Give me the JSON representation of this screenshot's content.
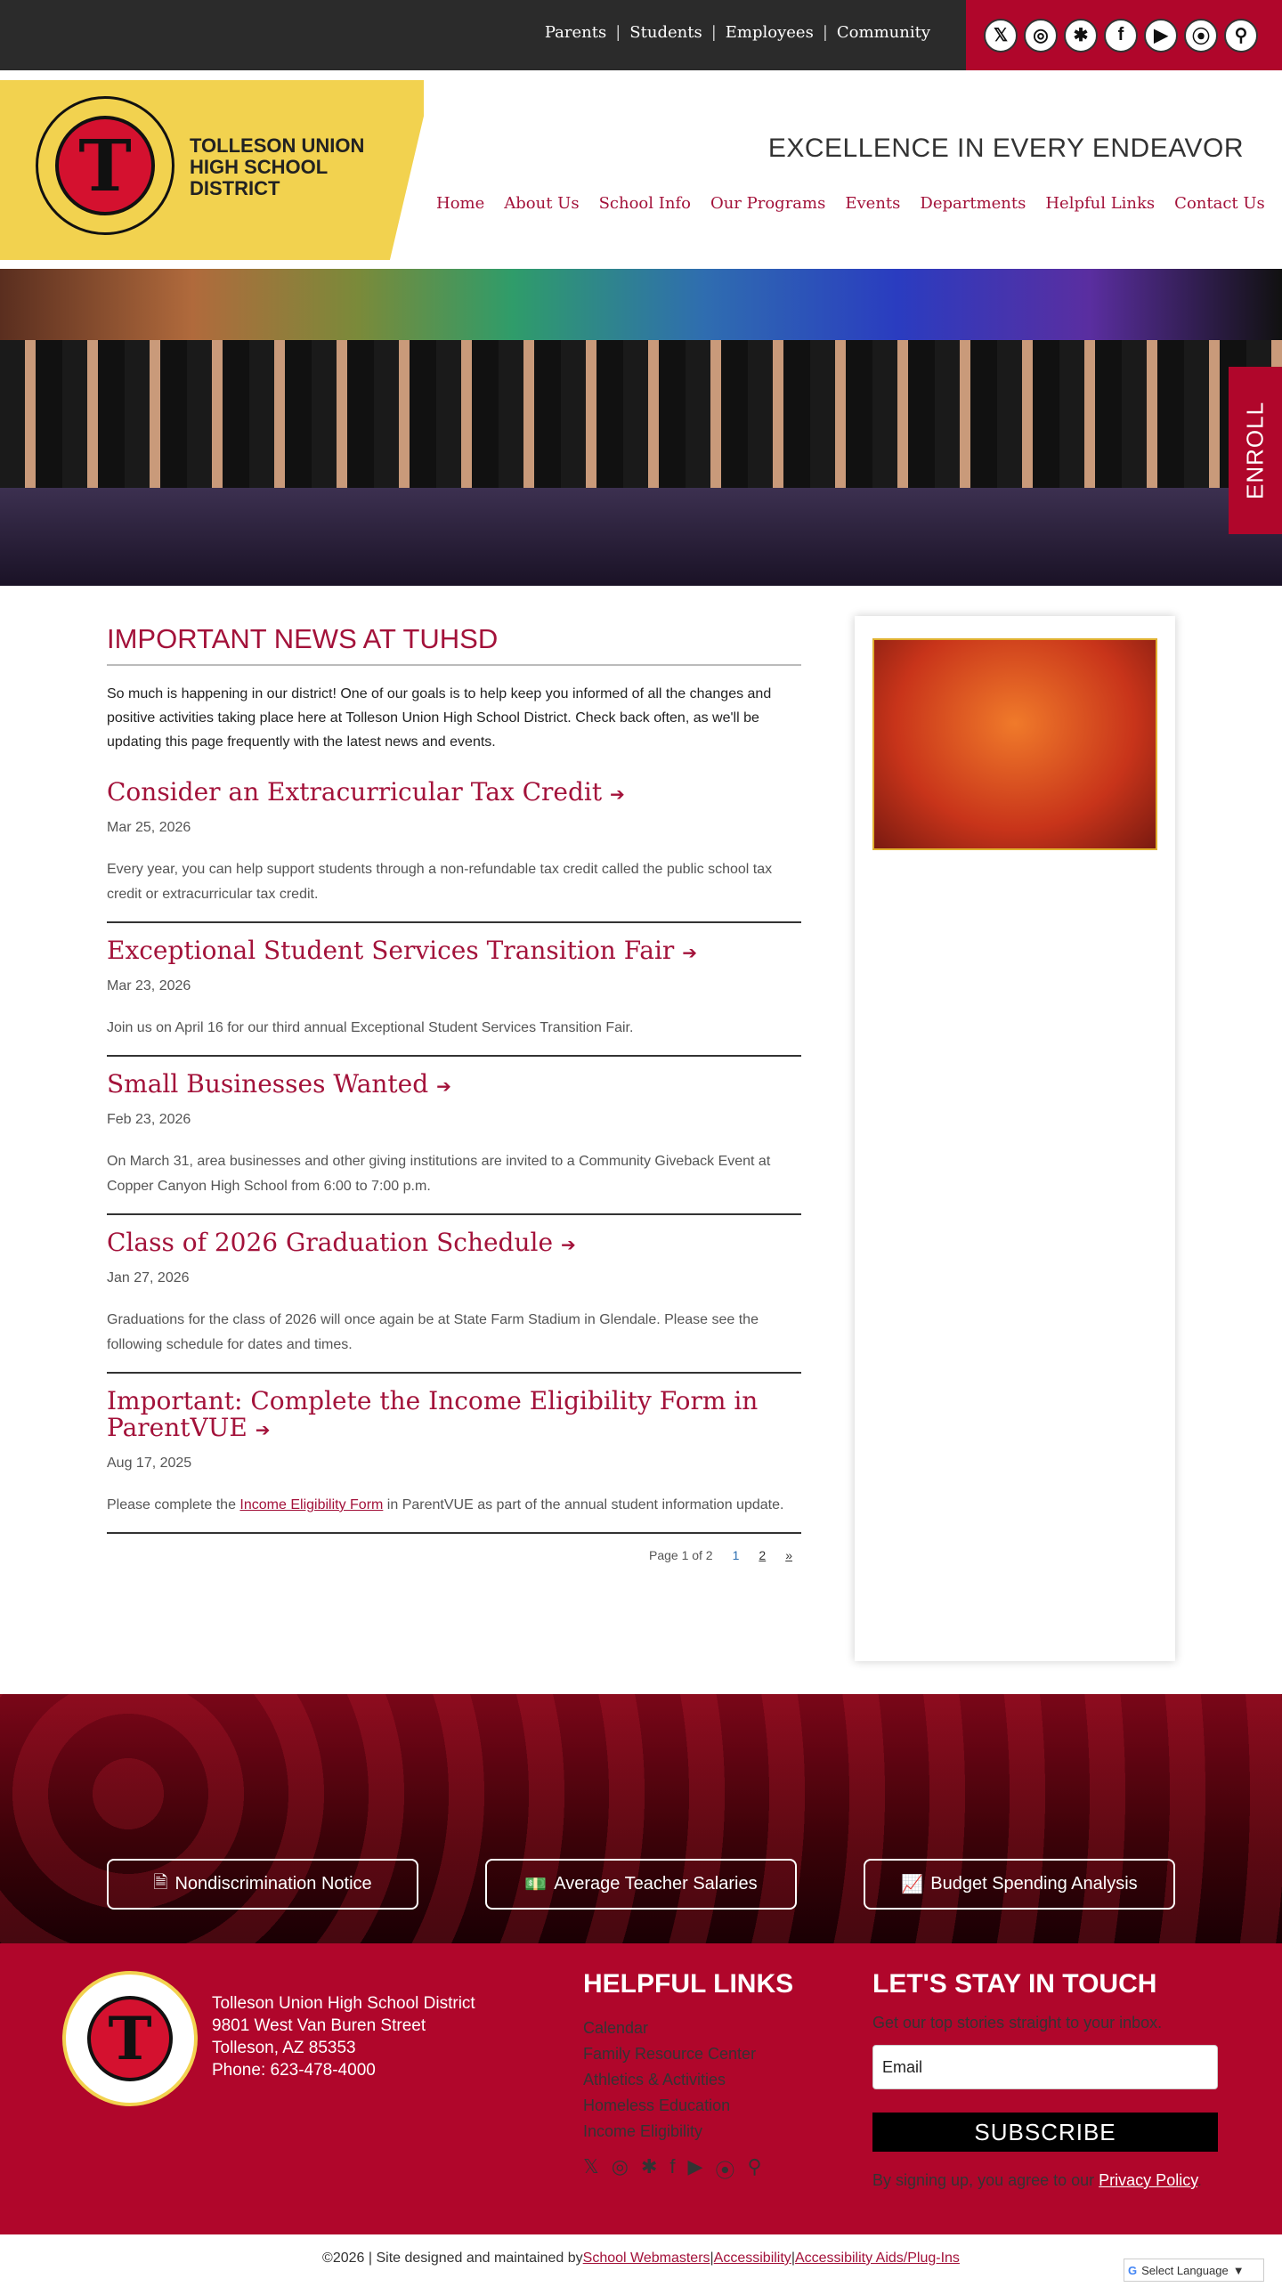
{
  "topbar": {
    "links": [
      "Parents",
      "Students",
      "Employees",
      "Community"
    ],
    "social_icons": [
      "x-icon",
      "instagram-icon",
      "linktree-icon",
      "facebook-icon",
      "youtube-icon",
      "podcast-icon",
      "search-icon"
    ]
  },
  "header": {
    "logo_text": "TOLLESON UNION HIGH SCHOOL DISTRICT",
    "logo_letter": "T",
    "tagline": "EXCELLENCE IN EVERY ENDEAVOR",
    "nav": [
      "Home",
      "About Us",
      "School Info",
      "Our Programs",
      "Events",
      "Departments",
      "Helpful Links",
      "Contact Us"
    ]
  },
  "enroll": "ENROLL",
  "main": {
    "title": "IMPORTANT NEWS AT TUHSD",
    "intro": "So much is happening in our district! One of our goals is to help keep you informed of all the changes and positive activities taking place here at Tolleson Union High School District. Check back often, as we'll be updating this page frequently with the latest news and events.",
    "articles": [
      {
        "title": "Consider an Extracurricular Tax Credit",
        "date": "Mar 25, 2026",
        "summary": "Every year, you can help support students through a non-refundable tax credit called the public school tax credit or extracurricular tax credit."
      },
      {
        "title": "Exceptional Student Services Transition Fair",
        "date": "Mar 23, 2026",
        "summary": "Join us on April 16 for our third annual Exceptional Student Services Transition Fair."
      },
      {
        "title": "Small Businesses Wanted",
        "date": "Feb 23, 2026",
        "summary": "On March 31, area businesses and other giving institutions are invited to a Community Giveback Event at Copper Canyon High School from 6:00 to 7:00 p.m."
      },
      {
        "title": "Class of 2026 Graduation Schedule",
        "date": "Jan 27, 2026",
        "summary": "Graduations for the class of 2026 will once again be at State Farm Stadium in Glendale. Please see the following schedule for dates and times."
      },
      {
        "title": "Important: Complete the Income Eligibility Form in ParentVUE",
        "date": "Aug 17, 2025",
        "summary_pre": "Please complete the ",
        "summary_link": "Income Eligibility Form",
        "summary_post": " in ParentVUE as part of the annual student information update."
      }
    ],
    "pager": {
      "label": "Page 1 of 2",
      "pages": [
        "1",
        "2"
      ],
      "next": "»"
    }
  },
  "cta": [
    "Nondiscrimination Notice",
    "Average Teacher Salaries",
    "Budget Spending Analysis"
  ],
  "footer": {
    "address": [
      "Tolleson Union High School District",
      "9801 West Van Buren Street",
      "Tolleson, AZ 85353",
      "Phone: 623-478-4000"
    ],
    "helpful_title": "HELPFUL LINKS",
    "helpful_links": [
      "Calendar",
      "Family Resource Center",
      "Athletics & Activities",
      "Homeless Education",
      "Income Eligibility"
    ],
    "touch_title": "LET'S STAY IN TOUCH",
    "touch_sub": "Get our top stories straight to your inbox.",
    "email_placeholder": "Email",
    "subscribe": "SUBSCRIBE",
    "agree_pre": "By signing up, you agree to our ",
    "agree_link": "Privacy Policy",
    "agree_post": "."
  },
  "bottom": {
    "copyright": "©2026 | Site designed and maintained by ",
    "links": [
      "School Webmasters",
      "Accessibility",
      "Accessibility Aids/Plug-Ins"
    ],
    "sep": " | ",
    "language": "Select Language"
  },
  "colors": {
    "brand_red": "#b0062b",
    "link_red": "#a3123a",
    "gold": "#f2d24f",
    "dark": "#2b2b2b"
  }
}
